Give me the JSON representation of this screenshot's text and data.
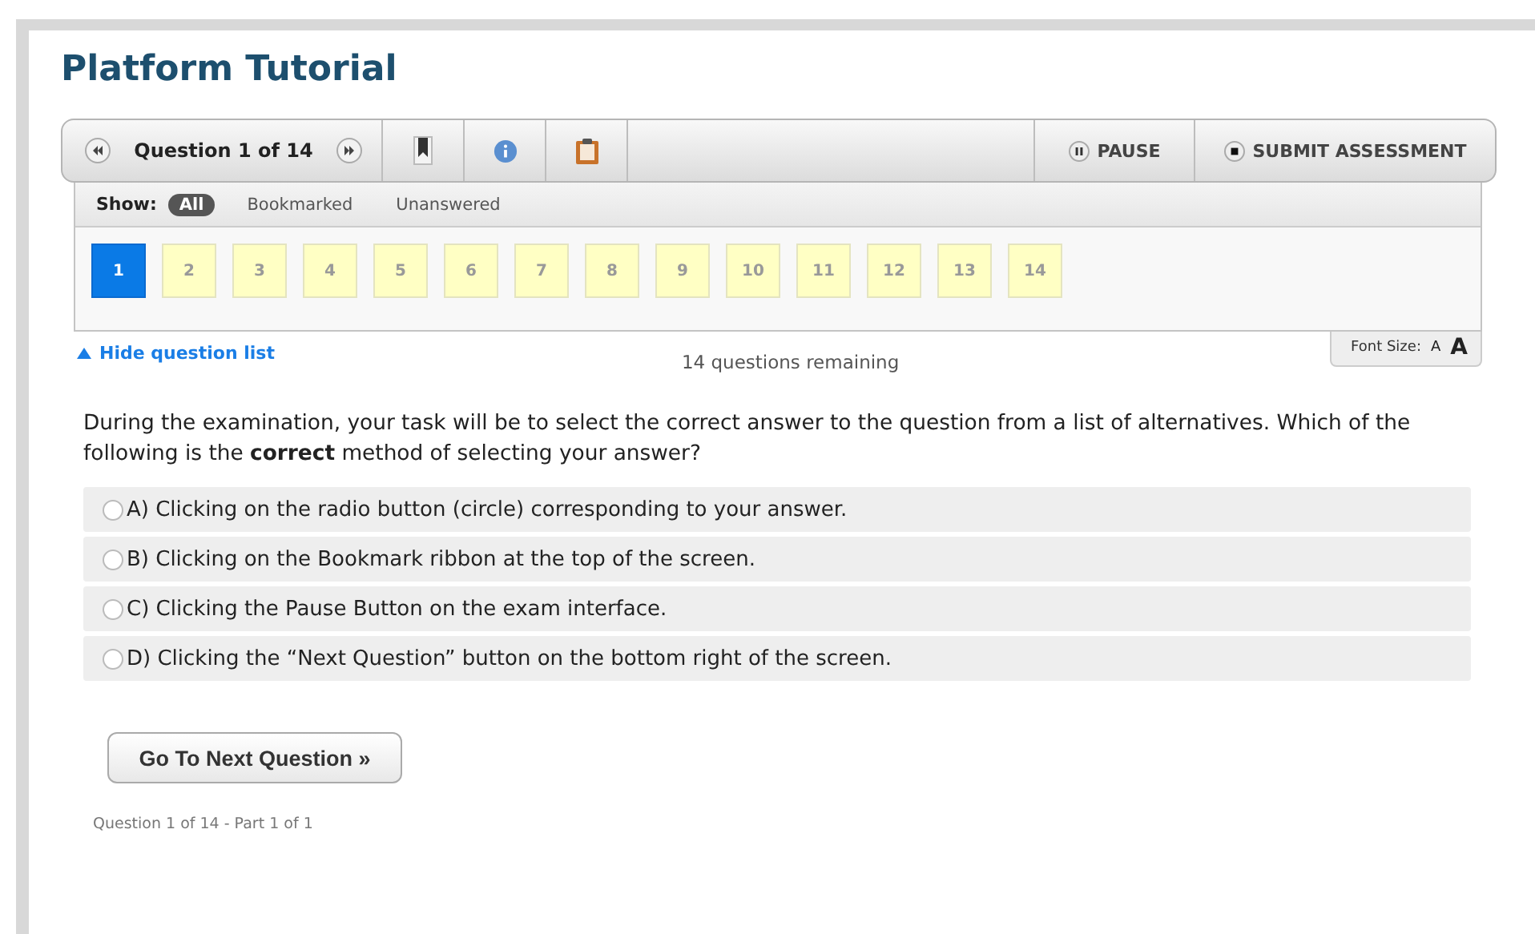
{
  "title": "Platform Tutorial",
  "toolbar": {
    "question_counter": "Question 1 of 14",
    "pause": "PAUSE",
    "submit": "SUBMIT ASSESSMENT"
  },
  "filter": {
    "label": "Show:",
    "options": [
      {
        "label": "All",
        "selected": true
      },
      {
        "label": "Bookmarked",
        "selected": false
      },
      {
        "label": "Unanswered",
        "selected": false
      }
    ]
  },
  "questions": [
    {
      "label": "1",
      "selected": true
    },
    {
      "label": "2",
      "selected": false
    },
    {
      "label": "3",
      "selected": false
    },
    {
      "label": "4",
      "selected": false
    },
    {
      "label": "5",
      "selected": false
    },
    {
      "label": "6",
      "selected": false
    },
    {
      "label": "7",
      "selected": false
    },
    {
      "label": "8",
      "selected": false
    },
    {
      "label": "9",
      "selected": false
    },
    {
      "label": "10",
      "selected": false
    },
    {
      "label": "11",
      "selected": false
    },
    {
      "label": "12",
      "selected": false
    },
    {
      "label": "13",
      "selected": false
    },
    {
      "label": "14",
      "selected": false
    }
  ],
  "hide_link": "Hide question list",
  "remaining": "14 questions remaining",
  "font_size": {
    "label": "Font Size:",
    "small": "A",
    "large": "A"
  },
  "question": "During the examination, your task will be to select the correct answer to the question from a list of alternatives. Which of the following is the **correct** method of selecting your answer?",
  "answers": [
    {
      "text": "A) Clicking on the radio button (circle) corresponding to your answer.",
      "selected": false
    },
    {
      "text": "B) Clicking on the Bookmark ribbon at the top of the screen.",
      "selected": false
    },
    {
      "text": "C) Clicking the Pause Button on the exam interface.",
      "selected": false
    },
    {
      "text": "D) Clicking the “Next Question” button on the bottom right of the screen.",
      "selected": false
    }
  ],
  "next_button": "Go To Next Question »",
  "footer": "Question 1 of 14 - Part 1 of 1"
}
